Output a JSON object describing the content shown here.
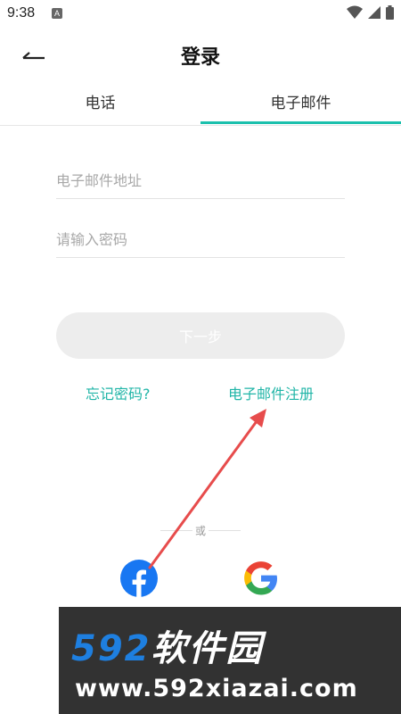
{
  "status_bar": {
    "time": "9:38",
    "app_icon": "A"
  },
  "header": {
    "back_icon": "back-arrow-icon",
    "title": "登录"
  },
  "tabs": [
    {
      "label": "电话",
      "active": false
    },
    {
      "label": "电子邮件",
      "active": true
    }
  ],
  "form": {
    "email_placeholder": "电子邮件地址",
    "password_placeholder": "请输入密码",
    "next_label": "下一步"
  },
  "links": {
    "forgot_password": "忘记密码?",
    "email_register": "电子邮件注册"
  },
  "divider_text": "或",
  "social": [
    {
      "name": "facebook",
      "icon": "facebook-icon",
      "color": "#1877f2"
    },
    {
      "name": "google",
      "icon": "google-icon"
    }
  ],
  "watermark": {
    "brand_num": "592",
    "brand_cn": "软件园",
    "url": "www.592xiazai.com"
  },
  "colors": {
    "accent": "#1bc0ad",
    "annotation_arrow": "#e74c4c",
    "button_disabled": "#ededed"
  }
}
